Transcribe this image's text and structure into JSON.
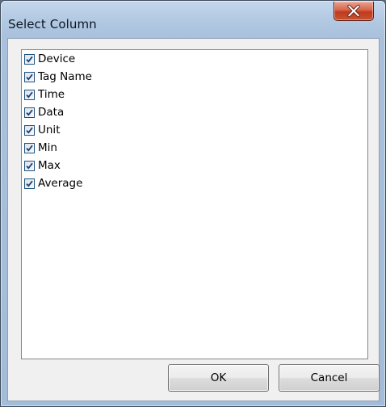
{
  "dialog": {
    "title": "Select Column"
  },
  "columns": [
    {
      "label": "Device",
      "checked": true
    },
    {
      "label": "Tag Name",
      "checked": true
    },
    {
      "label": "Time",
      "checked": true
    },
    {
      "label": "Data",
      "checked": true
    },
    {
      "label": "Unit",
      "checked": true
    },
    {
      "label": "Min",
      "checked": true
    },
    {
      "label": "Max",
      "checked": true
    },
    {
      "label": "Average",
      "checked": true
    }
  ],
  "buttons": {
    "ok_label": "OK",
    "cancel_label": "Cancel"
  },
  "icons": {
    "close": "close-icon",
    "check": "checkmark-icon"
  }
}
